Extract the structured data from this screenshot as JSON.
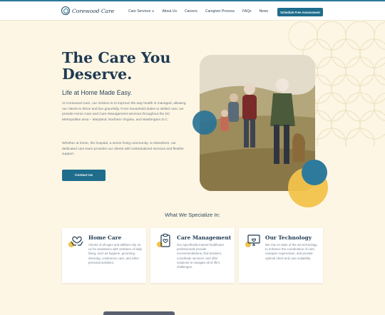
{
  "brand": {
    "name": "Corewood Care"
  },
  "nav": {
    "items": [
      "Care Services ∨",
      "About Us",
      "Careers",
      "Caregiver Process",
      "FAQs",
      "News"
    ],
    "cta": "Schedule Free Assessment"
  },
  "hero": {
    "title": "The Care You Deserve.",
    "subtitle": "Life at Home Made Easy.",
    "paragraph1": "At Corewood Care, our mission is to improve the way health is managed, allowing our clients to thrive and live gracefully. From household duties to skilled care, we provide Home Care and Care Management services throughout the DC Metropolitan area – Maryland, Northern Virginia, and Washington D.C.",
    "paragraph2": "Whether at home, the hospital, a senior living community, or elsewhere, our dedicated care team provides our clients with individualized services and flexible support.",
    "button": "Contact Us"
  },
  "specialize": {
    "heading": "What We Specialize In:",
    "cards": [
      {
        "icon": "hands-heart-icon",
        "title": "Home Care",
        "text": "Clients of all ages and abilities rely on us for assistance with activities of daily living, such as hygiene, grooming, dressing, continence care, and other personal activities."
      },
      {
        "icon": "clipboard-heart-icon",
        "title": "Care Management",
        "text": "Our specifically trained healthcare professionals provide recommendations, find answers, coordinate services, and offer solutions to navigate all of life's challenges."
      },
      {
        "icon": "monitor-heart-icon",
        "title": "Our Technology",
        "text": "We rely on state of the art technology to enhance the coordination of care, caregiver supervision, and provide optimal client and care suitability."
      }
    ]
  },
  "colors": {
    "primary": "#1e6d8c",
    "accent": "#f2c24a",
    "background": "#fdf6e4",
    "heading": "#1f3a52"
  }
}
